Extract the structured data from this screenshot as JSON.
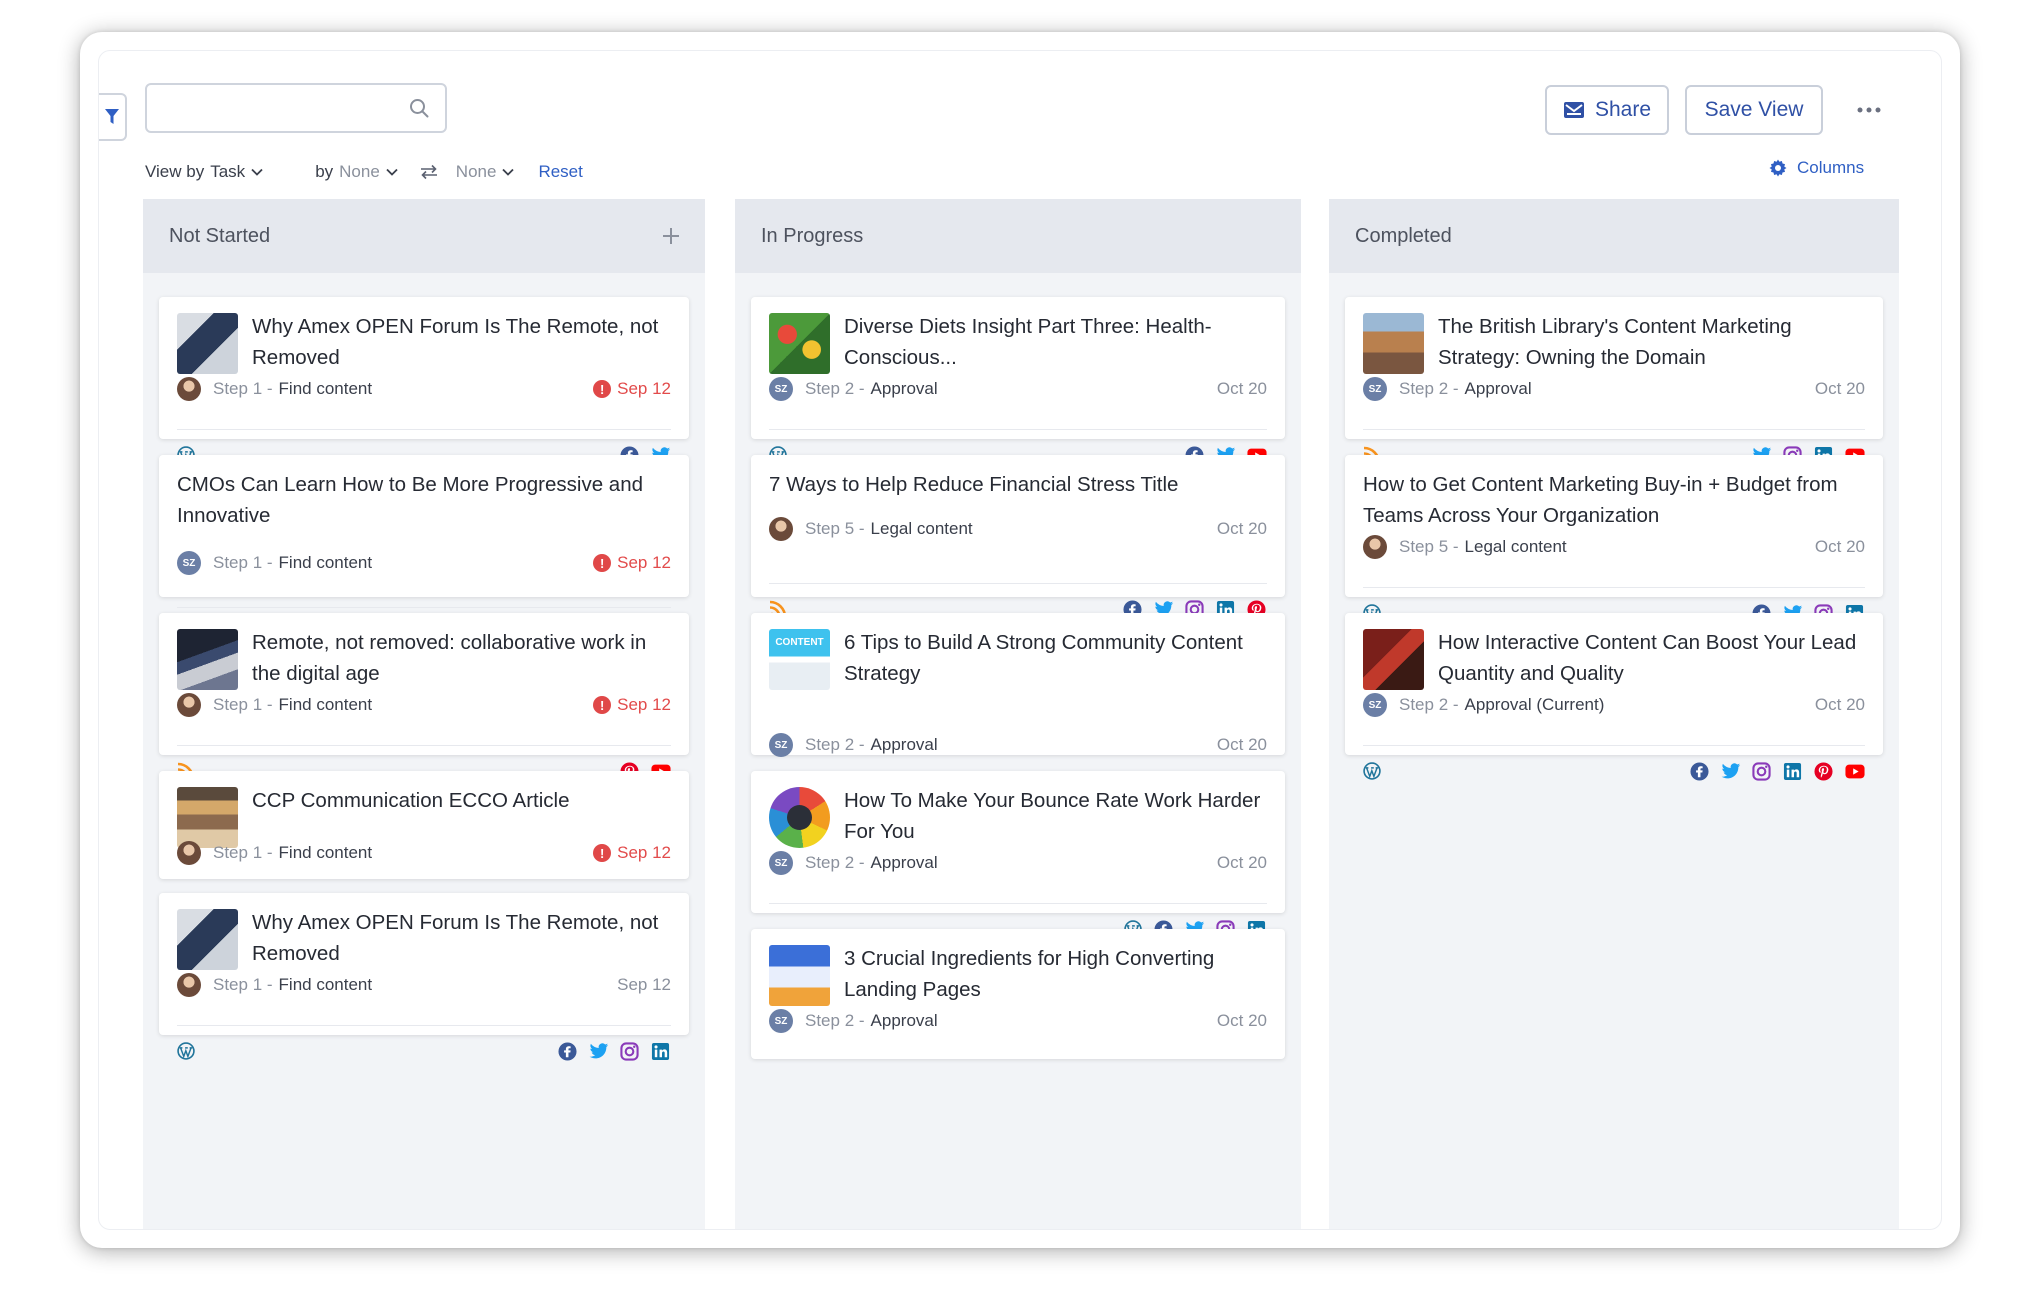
{
  "toolbar": {
    "search_placeholder": "",
    "share_label": "Share",
    "save_view_label": "Save View",
    "view_by_label": "View by",
    "view_by_value": "Task",
    "by_label": "by",
    "by_value": "None",
    "sort_value": "None",
    "reset_label": "Reset",
    "columns_label": "Columns"
  },
  "colors": {
    "accent": "#2f5fc4",
    "overdue": "#e24b4b",
    "facebook": "#3b5998",
    "twitter": "#1da1f2",
    "instagram": "#8a3ab9",
    "linkedin": "#0e76a8",
    "youtube": "#ff0000",
    "pinterest": "#e60023",
    "rss": "#f7931e",
    "wordpress": "#21759b"
  },
  "board": {
    "columns": [
      {
        "title": "Not Started",
        "cards": [
          {
            "title": "Why Amex OPEN Forum Is The Remote, not Removed",
            "step_no": "Step 1 - ",
            "step_name": "Find content",
            "date": "Sep 12",
            "overdue": true,
            "avatar": "photo",
            "thumb": "device",
            "left_icons": [
              "wordpress-icon"
            ],
            "right_icons": [
              "facebook-icon",
              "twitter-icon"
            ]
          },
          {
            "title": "CMOs Can Learn How to Be More Progressive and Innovative",
            "step_no": "Step 1 - ",
            "step_name": "Find content",
            "date": "Sep 12",
            "overdue": true,
            "avatar": "sz",
            "thumb": null,
            "left_icons": [],
            "right_icons": [
              "facebook-icon",
              "twitter-icon",
              "linkedin-icon"
            ]
          },
          {
            "title": "Remote, not removed: collaborative work in the digital age",
            "step_no": "Step 1 - ",
            "step_name": "Find content",
            "date": "Sep 12",
            "overdue": true,
            "avatar": "photo",
            "thumb": "laptop",
            "left_icons": [
              "rss-icon"
            ],
            "right_icons": [
              "pinterest-icon",
              "youtube-icon"
            ]
          },
          {
            "title": "CCP Communication ECCO Article",
            "step_no": "Step 1 - ",
            "step_name": "Find content",
            "date": "Sep 12",
            "overdue": true,
            "avatar": "photo",
            "thumb": "store",
            "left_icons": [],
            "right_icons": []
          },
          {
            "title": "Why Amex OPEN Forum Is The Remote, not Removed",
            "step_no": "Step 1 - ",
            "step_name": "Find content",
            "date": "Sep 12",
            "overdue": false,
            "avatar": "photo",
            "thumb": "device",
            "left_icons": [
              "wordpress-icon"
            ],
            "right_icons": [
              "facebook-icon",
              "twitter-icon",
              "instagram-icon",
              "linkedin-icon"
            ]
          }
        ]
      },
      {
        "title": "In Progress",
        "cards": [
          {
            "title": "Diverse Diets Insight Part Three: Health-Conscious...",
            "step_no": "Step 2 - ",
            "step_name": "Approval",
            "date": "Oct 20",
            "overdue": false,
            "avatar": "sz",
            "thumb": "food",
            "left_icons": [
              "wordpress-icon"
            ],
            "right_icons": [
              "facebook-icon",
              "twitter-icon",
              "youtube-icon"
            ]
          },
          {
            "title": "7 Ways to Help Reduce Financial Stress Title",
            "step_no": "Step 5 - ",
            "step_name": "Legal content",
            "date": "Oct 20",
            "overdue": false,
            "avatar": "photo",
            "thumb": null,
            "left_icons": [
              "rss-icon"
            ],
            "right_icons": [
              "facebook-icon",
              "twitter-icon",
              "instagram-icon",
              "linkedin-icon",
              "pinterest-icon"
            ]
          },
          {
            "title": "6 Tips to Build A Strong Community Content Strategy",
            "step_no": "Step 2 - ",
            "step_name": "Approval",
            "date": "Oct 20",
            "overdue": false,
            "avatar": "sz",
            "thumb": "content",
            "thumb_text": "CONTENT",
            "left_icons": [],
            "right_icons": []
          },
          {
            "title": "How To Make Your Bounce Rate Work Harder For You",
            "step_no": "Step 2 - ",
            "step_name": "Approval",
            "date": "Oct 20",
            "overdue": false,
            "avatar": "sz",
            "thumb": "wheel",
            "left_icons": [],
            "right_icons": [
              "wordpress-icon",
              "facebook-icon",
              "twitter-icon",
              "instagram-icon",
              "linkedin-icon"
            ]
          },
          {
            "title": "3 Crucial Ingredients for High Converting Landing Pages",
            "step_no": "Step 2 - ",
            "step_name": "Approval",
            "date": "Oct 20",
            "overdue": false,
            "avatar": "sz",
            "thumb": "landing",
            "left_icons": [],
            "right_icons": []
          }
        ]
      },
      {
        "title": "Completed",
        "cards": [
          {
            "title": "The British Library's Content Marketing Strategy: Owning the Domain",
            "step_no": "Step 2 - ",
            "step_name": "Approval",
            "date": "Oct 20",
            "overdue": false,
            "avatar": "sz",
            "thumb": "library",
            "left_icons": [
              "rss-icon"
            ],
            "right_icons": [
              "twitter-icon",
              "instagram-icon",
              "linkedin-icon",
              "youtube-icon"
            ]
          },
          {
            "title": "How to Get Content Marketing Buy-in + Budget from Teams Across Your Organization",
            "step_no": "Step 5 - ",
            "step_name": "Legal content",
            "date": "Oct 20",
            "overdue": false,
            "avatar": "photo",
            "thumb": null,
            "left_icons": [
              "wordpress-icon"
            ],
            "right_icons": [
              "facebook-icon",
              "twitter-icon",
              "instagram-icon",
              "linkedin-icon"
            ]
          },
          {
            "title": "How Interactive Content Can Boost Your Lead Quantity and Quality",
            "step_no": "Step 2 - ",
            "step_name": "Approval (Current)",
            "date": "Oct 20",
            "overdue": false,
            "avatar": "sz",
            "thumb": "event",
            "left_icons": [
              "wordpress-icon"
            ],
            "right_icons": [
              "facebook-icon",
              "twitter-icon",
              "instagram-icon",
              "linkedin-icon",
              "pinterest-icon",
              "youtube-icon"
            ]
          }
        ]
      }
    ]
  }
}
